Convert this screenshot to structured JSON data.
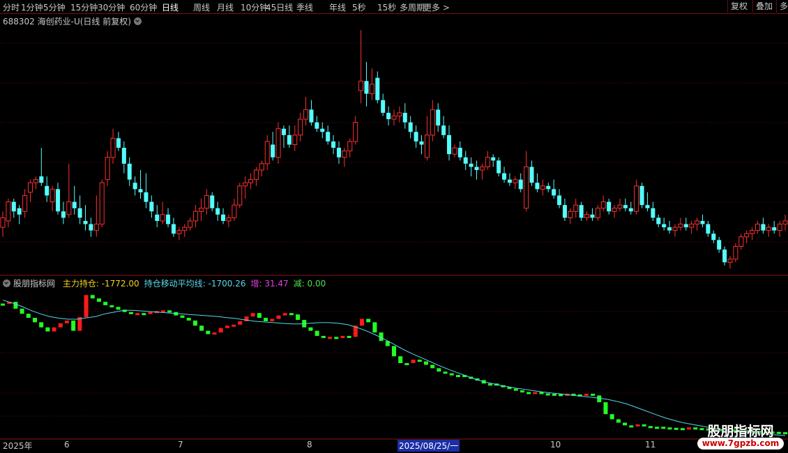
{
  "toolbar": {
    "timeframes": [
      "分时",
      "1分钟",
      "5分钟",
      "15分钟",
      "30分钟",
      "60分钟",
      "日线",
      "周线",
      "月线",
      "10分钟",
      "45日线",
      "季线",
      "年线",
      "5秒",
      "15秒",
      "多周期",
      "更多 >"
    ],
    "active": "日线",
    "right_buttons": [
      "复权",
      "叠加",
      "多"
    ]
  },
  "main_panel": {
    "title": "688302 海创药业-U(日线 前复权)"
  },
  "indicator_panel": {
    "name": "股朋指标网",
    "items": [
      {
        "label": "主力持仓: -1772.00",
        "color": "#f2d31b"
      },
      {
        "label": "持仓移动平均线: -1700.26",
        "color": "#5ad8e8"
      },
      {
        "label": "增: 31.47",
        "color": "#e040e0"
      },
      {
        "label": "减: 0.00",
        "color": "#4ee04e"
      }
    ]
  },
  "date_axis": {
    "labels": [
      "2025年",
      "6",
      "7",
      "8",
      "10",
      "11"
    ],
    "selected": "2025/08/25/一"
  },
  "watermark": {
    "title": "股朋指标网",
    "url": "www.7gpzb.com"
  },
  "colors": {
    "up": "#ff3030",
    "down": "#54ffff",
    "ma": "#54d8ee",
    "pos": "#ff1a1a",
    "neg": "#22ff22",
    "grid": "#6b1010"
  },
  "chart_data": {
    "type": "candlestick",
    "series": [
      {
        "name": "K线",
        "points": [
          [
            10.4,
            10.9,
            10.1,
            10.7
          ],
          [
            10.6,
            11.3,
            10.4,
            11.2
          ],
          [
            11.2,
            11.3,
            10.7,
            10.9
          ],
          [
            11.0,
            11.1,
            10.5,
            10.8
          ],
          [
            10.9,
            11.6,
            10.7,
            11.4
          ],
          [
            11.5,
            11.9,
            11.2,
            11.8
          ],
          [
            11.8,
            12.0,
            11.6,
            11.9
          ],
          [
            12.0,
            12.9,
            11.7,
            11.8
          ],
          [
            11.7,
            12.0,
            11.2,
            11.4
          ],
          [
            11.2,
            11.7,
            10.9,
            11.6
          ],
          [
            11.6,
            11.8,
            10.8,
            10.9
          ],
          [
            10.9,
            11.2,
            10.5,
            10.7
          ],
          [
            10.8,
            12.4,
            10.7,
            11.2
          ],
          [
            11.2,
            11.7,
            10.8,
            11.0
          ],
          [
            11.0,
            11.4,
            10.5,
            10.7
          ],
          [
            10.6,
            11.1,
            10.3,
            10.5
          ],
          [
            10.5,
            10.7,
            10.1,
            10.3
          ],
          [
            10.3,
            11.4,
            10.1,
            10.5
          ],
          [
            10.5,
            11.9,
            10.4,
            11.8
          ],
          [
            11.9,
            12.8,
            11.7,
            12.6
          ],
          [
            12.6,
            13.5,
            12.4,
            13.2
          ],
          [
            13.2,
            13.4,
            12.8,
            12.9
          ],
          [
            12.9,
            13.1,
            12.1,
            12.4
          ],
          [
            12.4,
            12.6,
            11.7,
            11.9
          ],
          [
            11.8,
            12.0,
            11.4,
            11.6
          ],
          [
            11.6,
            12.2,
            11.3,
            11.5
          ],
          [
            11.5,
            12.1,
            11.0,
            11.2
          ],
          [
            11.2,
            11.4,
            10.7,
            10.9
          ],
          [
            10.8,
            11.1,
            10.4,
            10.6
          ],
          [
            10.6,
            11.2,
            10.5,
            10.8
          ],
          [
            10.8,
            11.0,
            10.4,
            10.5
          ],
          [
            10.5,
            10.7,
            10.1,
            10.2
          ],
          [
            10.2,
            10.4,
            10.0,
            10.3
          ],
          [
            10.3,
            10.5,
            10.1,
            10.4
          ],
          [
            10.4,
            10.7,
            10.3,
            10.6
          ],
          [
            10.6,
            11.1,
            10.4,
            10.9
          ],
          [
            10.9,
            11.3,
            10.6,
            11.0
          ],
          [
            11.0,
            11.6,
            10.8,
            11.4
          ],
          [
            11.4,
            11.5,
            10.9,
            11.0
          ],
          [
            11.0,
            11.2,
            10.6,
            10.8
          ],
          [
            10.8,
            11.0,
            10.5,
            10.6
          ],
          [
            10.6,
            10.8,
            10.4,
            10.7
          ],
          [
            10.7,
            11.3,
            10.6,
            11.1
          ],
          [
            11.1,
            11.8,
            11.0,
            11.7
          ],
          [
            11.7,
            12.0,
            11.3,
            11.8
          ],
          [
            11.8,
            12.1,
            11.6,
            11.9
          ],
          [
            11.9,
            12.3,
            11.7,
            12.2
          ],
          [
            12.2,
            12.5,
            12.0,
            12.4
          ],
          [
            12.4,
            13.3,
            12.2,
            13.1
          ],
          [
            13.0,
            13.4,
            12.5,
            12.6
          ],
          [
            12.6,
            13.7,
            12.4,
            13.5
          ],
          [
            13.5,
            13.6,
            12.9,
            13.3
          ],
          [
            13.3,
            13.6,
            12.9,
            13.0
          ],
          [
            13.0,
            13.6,
            12.8,
            13.3
          ],
          [
            13.3,
            14.0,
            13.1,
            13.8
          ],
          [
            13.8,
            14.5,
            13.6,
            14.1
          ],
          [
            14.1,
            14.4,
            13.6,
            13.7
          ],
          [
            13.7,
            13.9,
            13.4,
            13.5
          ],
          [
            13.5,
            13.7,
            13.2,
            13.4
          ],
          [
            13.4,
            13.6,
            13.0,
            13.1
          ],
          [
            13.1,
            13.3,
            12.7,
            12.9
          ],
          [
            12.9,
            13.1,
            12.4,
            12.6
          ],
          [
            12.6,
            12.9,
            12.3,
            12.8
          ],
          [
            12.8,
            13.2,
            12.6,
            13.1
          ],
          [
            13.1,
            13.9,
            13.0,
            13.7
          ],
          [
            14.7,
            16.6,
            14.3,
            15.0
          ],
          [
            15.0,
            15.6,
            14.2,
            14.6
          ],
          [
            14.6,
            15.4,
            14.4,
            14.9
          ],
          [
            15.1,
            15.3,
            14.3,
            14.4
          ],
          [
            14.4,
            14.6,
            13.9,
            14.0
          ],
          [
            14.0,
            14.2,
            13.6,
            13.8
          ],
          [
            13.8,
            14.1,
            13.6,
            13.9
          ],
          [
            13.9,
            14.2,
            13.7,
            14.0
          ],
          [
            14.0,
            14.3,
            13.5,
            13.7
          ],
          [
            13.7,
            13.9,
            13.2,
            13.4
          ],
          [
            13.4,
            13.6,
            12.9,
            13.1
          ],
          [
            13.1,
            13.3,
            12.7,
            13.0
          ],
          [
            12.6,
            13.9,
            12.5,
            13.3
          ],
          [
            13.3,
            14.4,
            13.1,
            14.1
          ],
          [
            14.1,
            14.3,
            13.4,
            13.6
          ],
          [
            13.6,
            13.9,
            13.2,
            13.3
          ],
          [
            13.3,
            13.6,
            12.5,
            12.7
          ],
          [
            12.7,
            13.0,
            12.6,
            12.9
          ],
          [
            12.9,
            13.1,
            12.5,
            12.6
          ],
          [
            12.6,
            12.8,
            12.2,
            12.4
          ],
          [
            12.4,
            12.6,
            12.0,
            12.3
          ],
          [
            12.3,
            12.5,
            11.9,
            12.2
          ],
          [
            12.2,
            12.4,
            11.9,
            12.3
          ],
          [
            12.3,
            12.8,
            12.2,
            12.6
          ],
          [
            12.6,
            12.7,
            12.3,
            12.5
          ],
          [
            12.5,
            12.6,
            12.0,
            12.1
          ],
          [
            12.1,
            12.3,
            11.8,
            11.9
          ],
          [
            11.9,
            12.1,
            11.7,
            11.8
          ],
          [
            11.8,
            12.0,
            11.6,
            11.9
          ],
          [
            11.9,
            12.1,
            11.5,
            11.6
          ],
          [
            11.0,
            12.8,
            10.9,
            12.3
          ],
          [
            12.3,
            12.5,
            11.7,
            11.8
          ],
          [
            11.8,
            12.1,
            11.5,
            11.6
          ],
          [
            11.6,
            11.9,
            11.4,
            11.7
          ],
          [
            11.7,
            11.8,
            11.5,
            11.6
          ],
          [
            11.6,
            11.9,
            11.3,
            11.4
          ],
          [
            11.4,
            11.6,
            11.0,
            11.1
          ],
          [
            11.1,
            11.3,
            10.6,
            10.7
          ],
          [
            10.7,
            11.0,
            10.5,
            10.9
          ],
          [
            10.9,
            11.3,
            10.7,
            11.1
          ],
          [
            11.1,
            11.2,
            10.6,
            10.7
          ],
          [
            10.7,
            10.9,
            10.6,
            10.8
          ],
          [
            10.8,
            11.0,
            10.6,
            10.7
          ],
          [
            10.7,
            11.1,
            10.6,
            11.0
          ],
          [
            11.0,
            11.4,
            10.9,
            11.2
          ],
          [
            11.2,
            11.3,
            10.8,
            10.9
          ],
          [
            10.9,
            11.1,
            10.7,
            11.0
          ],
          [
            11.0,
            11.3,
            10.9,
            11.1
          ],
          [
            11.1,
            11.3,
            10.9,
            11.0
          ],
          [
            11.0,
            11.2,
            10.8,
            10.9
          ],
          [
            10.9,
            11.9,
            10.8,
            11.7
          ],
          [
            11.7,
            11.8,
            11.0,
            11.1
          ],
          [
            11.1,
            11.5,
            10.9,
            11.0
          ],
          [
            11.0,
            11.2,
            10.6,
            10.7
          ],
          [
            10.7,
            10.8,
            10.4,
            10.5
          ],
          [
            10.5,
            10.7,
            10.3,
            10.4
          ],
          [
            10.4,
            10.6,
            10.2,
            10.3
          ],
          [
            10.3,
            10.5,
            10.1,
            10.4
          ],
          [
            10.4,
            10.7,
            10.3,
            10.5
          ],
          [
            10.5,
            10.7,
            10.3,
            10.4
          ],
          [
            10.4,
            10.6,
            10.2,
            10.5
          ],
          [
            10.5,
            10.7,
            10.3,
            10.6
          ],
          [
            10.6,
            10.8,
            10.4,
            10.5
          ],
          [
            10.5,
            10.6,
            10.1,
            10.2
          ],
          [
            10.2,
            10.3,
            9.9,
            10.0
          ],
          [
            10.0,
            10.1,
            9.6,
            9.7
          ],
          [
            9.7,
            9.8,
            9.2,
            9.3
          ],
          [
            9.3,
            9.5,
            9.1,
            9.4
          ],
          [
            9.4,
            9.9,
            9.3,
            9.8
          ],
          [
            9.8,
            10.2,
            9.7,
            10.1
          ],
          [
            10.1,
            10.3,
            9.9,
            10.2
          ],
          [
            10.2,
            10.4,
            10.0,
            10.3
          ],
          [
            10.3,
            10.6,
            10.2,
            10.5
          ],
          [
            10.5,
            10.7,
            10.2,
            10.3
          ],
          [
            10.3,
            10.5,
            10.1,
            10.4
          ],
          [
            10.4,
            10.6,
            10.2,
            10.3
          ],
          [
            10.3,
            10.6,
            10.1,
            10.5
          ],
          [
            10.5,
            10.8,
            10.3,
            10.6
          ]
        ]
      },
      {
        "name": "主力持仓",
        "values": [
          -1220,
          -1215,
          -1235,
          -1250,
          -1262,
          -1275,
          -1290,
          -1302,
          -1290,
          -1278,
          -1270,
          -1300,
          -1260,
          -1195,
          -1205,
          -1215,
          -1225,
          -1230,
          -1238,
          -1245,
          -1250,
          -1248,
          -1250,
          -1245,
          -1242,
          -1240,
          -1245,
          -1255,
          -1262,
          -1270,
          -1285,
          -1300,
          -1310,
          -1305,
          -1292,
          -1285,
          -1282,
          -1272,
          -1258,
          -1248,
          -1262,
          -1272,
          -1265,
          -1255,
          -1248,
          -1252,
          -1268,
          -1290,
          -1300,
          -1315,
          -1320,
          -1318,
          -1320,
          -1315,
          -1318,
          -1285,
          -1265,
          -1275,
          -1305,
          -1330,
          -1345,
          -1375,
          -1395,
          -1395,
          -1385,
          -1390,
          -1400,
          -1410,
          -1420,
          -1425,
          -1430,
          -1430,
          -1435,
          -1440,
          -1445,
          -1455,
          -1455,
          -1460,
          -1465,
          -1470,
          -1475,
          -1480,
          -1482,
          -1480,
          -1484,
          -1485,
          -1486,
          -1486,
          -1485,
          -1487,
          -1488,
          -1485,
          -1490,
          -1510,
          -1545,
          -1560,
          -1570,
          -1578,
          -1580,
          -1575,
          -1580,
          -1582,
          -1582,
          -1584,
          -1585,
          -1586,
          -1586,
          -1584,
          -1586,
          -1587,
          -1588,
          -1589,
          -1590,
          -1590,
          -1591,
          -1592,
          -1594,
          -1594,
          -1595,
          -1596,
          -1597,
          -1598,
          -1598
        ],
        "ma": [
          -1210,
          -1218,
          -1228,
          -1240,
          -1250,
          -1258,
          -1263,
          -1266,
          -1266,
          -1262,
          -1258,
          -1250,
          -1245,
          -1240,
          -1240,
          -1242,
          -1244,
          -1246,
          -1248,
          -1250,
          -1252,
          -1254,
          -1256,
          -1258,
          -1261,
          -1264,
          -1268,
          -1272,
          -1274,
          -1276,
          -1278,
          -1280,
          -1280,
          -1278,
          -1276,
          -1276,
          -1278,
          -1282,
          -1290,
          -1300,
          -1312,
          -1325,
          -1340,
          -1355,
          -1368,
          -1380,
          -1392,
          -1404,
          -1415,
          -1425,
          -1435,
          -1445,
          -1452,
          -1458,
          -1463,
          -1468,
          -1472,
          -1476,
          -1480,
          -1483,
          -1486,
          -1489,
          -1492,
          -1495,
          -1498,
          -1502,
          -1508,
          -1515,
          -1525,
          -1535,
          -1545,
          -1555,
          -1563,
          -1570,
          -1575,
          -1580,
          -1585,
          -1590,
          -1594,
          -1597,
          -1600,
          -1602,
          -1604,
          -1606,
          -1608
        ]
      }
    ]
  }
}
